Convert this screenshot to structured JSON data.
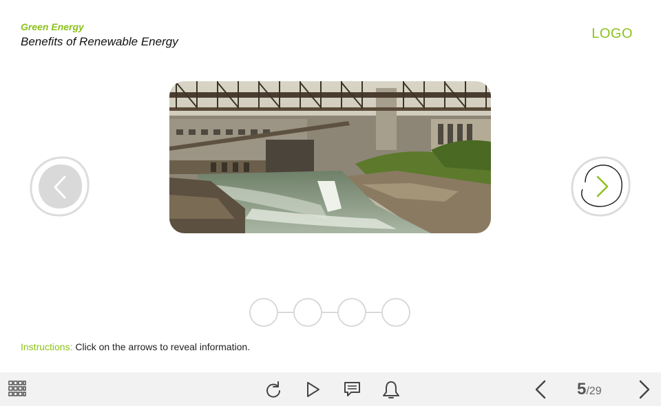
{
  "header": {
    "subtitle": "Green Energy",
    "title": "Benefits of Renewable Energy",
    "logo": "LOGO"
  },
  "slide": {
    "image_icon": "hydroelectric-dam-photo",
    "prev_icon": "chevron-left-icon",
    "next_icon": "chevron-right-icon",
    "step_count": 4
  },
  "instructions": {
    "label": "Instructions:",
    "text": " Click on the arrows to reveal information."
  },
  "toolbar": {
    "menu_icon": "grid-menu-icon",
    "replay_icon": "replay-icon",
    "play_icon": "play-icon",
    "notes_icon": "notes-icon",
    "notify_icon": "bell-icon",
    "page_current": "5",
    "page_total": "/29"
  },
  "colors": {
    "accent": "#8cc21b",
    "toolbar_bg": "#f2f2f2",
    "circle_stroke": "#d9d9d9"
  }
}
